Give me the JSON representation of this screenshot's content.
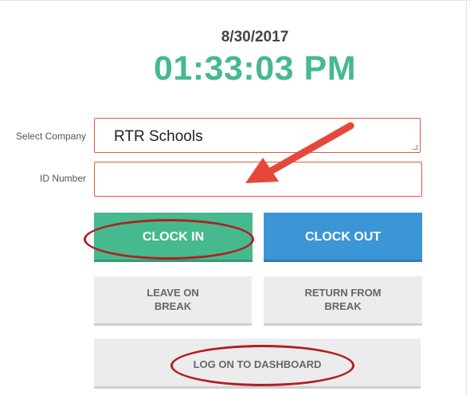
{
  "clock": {
    "date": "8/30/2017",
    "time": "01:33:03 PM"
  },
  "form": {
    "company_label": "Select Company",
    "company_value": "RTR Schools",
    "id_label": "ID Number",
    "id_value": "",
    "id_placeholder": ""
  },
  "buttons": {
    "clock_in": "CLOCK IN",
    "clock_out": "CLOCK OUT",
    "leave_break_line1": "LEAVE ON",
    "leave_break_line2": "BREAK",
    "return_break_line1": "RETURN FROM",
    "return_break_line2": "BREAK",
    "dashboard": "LOG ON TO DASHBOARD"
  },
  "colors": {
    "accent_green": "#46b98e",
    "accent_blue": "#3c96d6",
    "field_border": "#e8573d",
    "annotation_red": "#b01f24",
    "arrow_red": "#e5483b"
  },
  "annotations": {
    "arrow": "pointing to ID Number field",
    "circled": [
      "clock-in-button",
      "dashboard-button"
    ]
  }
}
